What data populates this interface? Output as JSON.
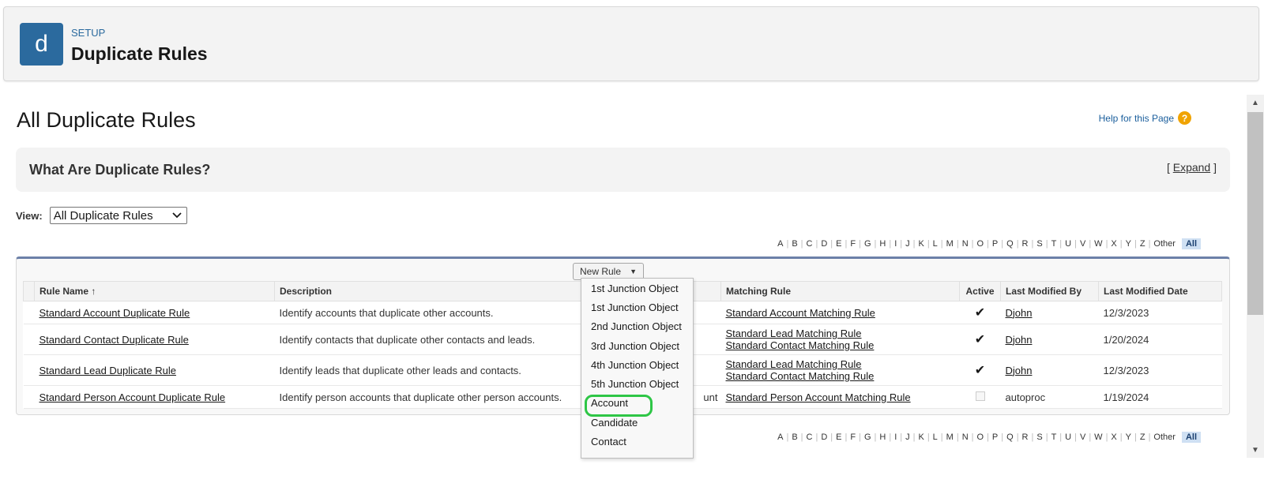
{
  "header": {
    "icon_letter": "d",
    "setup_label": "SETUP",
    "title": "Duplicate Rules"
  },
  "page": {
    "title": "All Duplicate Rules",
    "help_link": "Help for this Page"
  },
  "info_box": {
    "title": "What Are Duplicate Rules?",
    "expand_open": "[",
    "expand_label": "Expand",
    "expand_close": "]"
  },
  "view": {
    "label": "View:",
    "selected": "All Duplicate Rules"
  },
  "alphabet": [
    "A",
    "B",
    "C",
    "D",
    "E",
    "F",
    "G",
    "H",
    "I",
    "J",
    "K",
    "L",
    "M",
    "N",
    "O",
    "P",
    "Q",
    "R",
    "S",
    "T",
    "U",
    "V",
    "W",
    "X",
    "Y",
    "Z",
    "Other"
  ],
  "alphabet_all": "All",
  "new_rule_button": "New Rule",
  "table": {
    "columns": [
      "Rule Name",
      "Description",
      "Matching Rule",
      "Active",
      "Last Modified By",
      "Last Modified Date"
    ],
    "sort_indicator": "↑",
    "rows": [
      {
        "name": "Standard Account Duplicate Rule",
        "description": "Identify accounts that duplicate other accounts.",
        "object": "",
        "matching": [
          "Standard Account Matching Rule"
        ],
        "active": true,
        "modified_by": "Djohn",
        "modified_by_link": true,
        "date": "12/3/2023"
      },
      {
        "name": "Standard Contact Duplicate Rule",
        "description": "Identify contacts that duplicate other contacts and leads.",
        "object": "",
        "matching": [
          "Standard Lead Matching Rule",
          "Standard Contact Matching Rule"
        ],
        "active": true,
        "modified_by": "Djohn",
        "modified_by_link": true,
        "date": "1/20/2024"
      },
      {
        "name": "Standard Lead Duplicate Rule",
        "description": "Identify leads that duplicate other leads and contacts.",
        "object": "",
        "matching": [
          "Standard Lead Matching Rule",
          "Standard Contact Matching Rule"
        ],
        "active": true,
        "modified_by": "Djohn",
        "modified_by_link": true,
        "date": "12/3/2023"
      },
      {
        "name": "Standard Person Account Duplicate Rule",
        "description": "Identify person accounts that duplicate other person accounts.",
        "object": "unt",
        "matching": [
          "Standard Person Account Matching Rule"
        ],
        "active": false,
        "modified_by": "autoproc",
        "modified_by_link": false,
        "date": "1/19/2024"
      }
    ]
  },
  "dropdown": {
    "options": [
      "1st Junction Object",
      "1st Junction Object",
      "2nd Junction Object",
      "3rd Junction Object",
      "4th Junction Object",
      "5th Junction Object",
      "Account",
      "Candidate",
      "Contact"
    ],
    "highlighted_index": 6
  },
  "colors": {
    "brand": "#2b6a9e",
    "highlight_ring": "#2ec646",
    "help_icon": "#f0a300"
  }
}
